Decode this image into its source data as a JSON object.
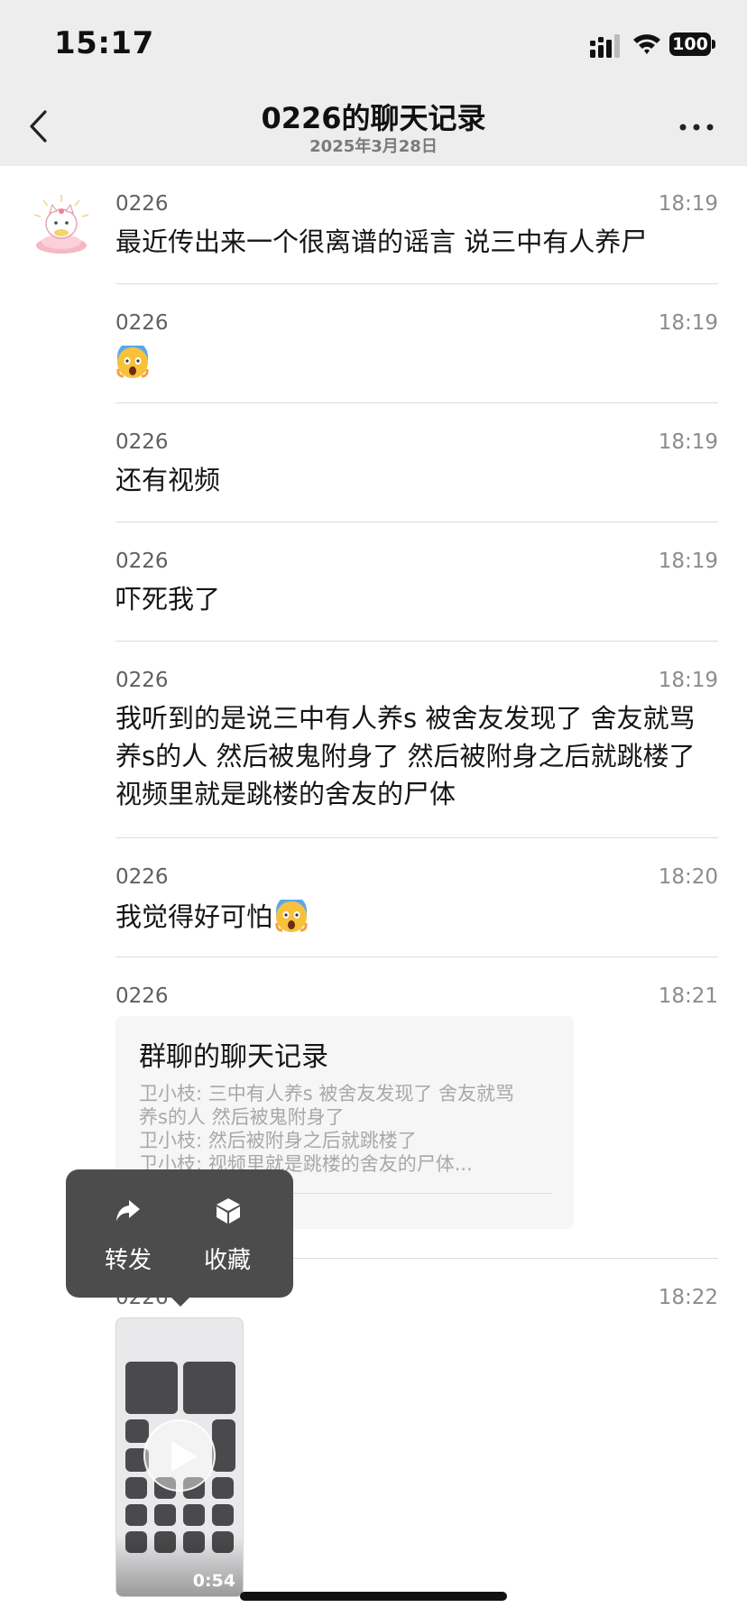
{
  "status_bar": {
    "time": "15:17",
    "battery": "100"
  },
  "header": {
    "title": "0226的聊天记录",
    "date": "2025年3月28日"
  },
  "messages": [
    {
      "sender": "0226",
      "time": "18:19",
      "text": "最近传出来一个很离谱的谣言 说三中有人养尸"
    },
    {
      "sender": "0226",
      "time": "18:19",
      "emoji": "scream-emoji"
    },
    {
      "sender": "0226",
      "time": "18:19",
      "text": "还有视频"
    },
    {
      "sender": "0226",
      "time": "18:19",
      "text": "吓死我了"
    },
    {
      "sender": "0226",
      "time": "18:19",
      "lines": [
        "我听到的是说三中有人养s 被舍友发现了 舍友就骂",
        "养s的人 然后被鬼附身了 然后被附身之后就跳楼了",
        "视频里就是跳楼的舍友的尸体"
      ]
    },
    {
      "sender": "0226",
      "time": "18:20",
      "text": "我觉得好可怕",
      "emoji": "scream-emoji"
    },
    {
      "sender": "0226",
      "time": "18:21",
      "card": {
        "title": "群聊的聊天记录",
        "lines": [
          "卫小枝: 三中有人养s 被舍友发现了 舍友就骂",
          "养s的人 然后被鬼附身了",
          "卫小枝: 然后被附身之后就跳楼了",
          "卫小枝: 视频里就是跳楼的舍友的尸体..."
        ]
      }
    },
    {
      "sender": "0226",
      "time": "18:22",
      "video_duration": "0:54"
    }
  ],
  "popup": {
    "forward_label": "转发",
    "favorite_label": "收藏"
  },
  "colors": {
    "header_bg": "#ededed",
    "popup_bg": "#4c4c4c",
    "card_bg": "#f6f6f6"
  }
}
